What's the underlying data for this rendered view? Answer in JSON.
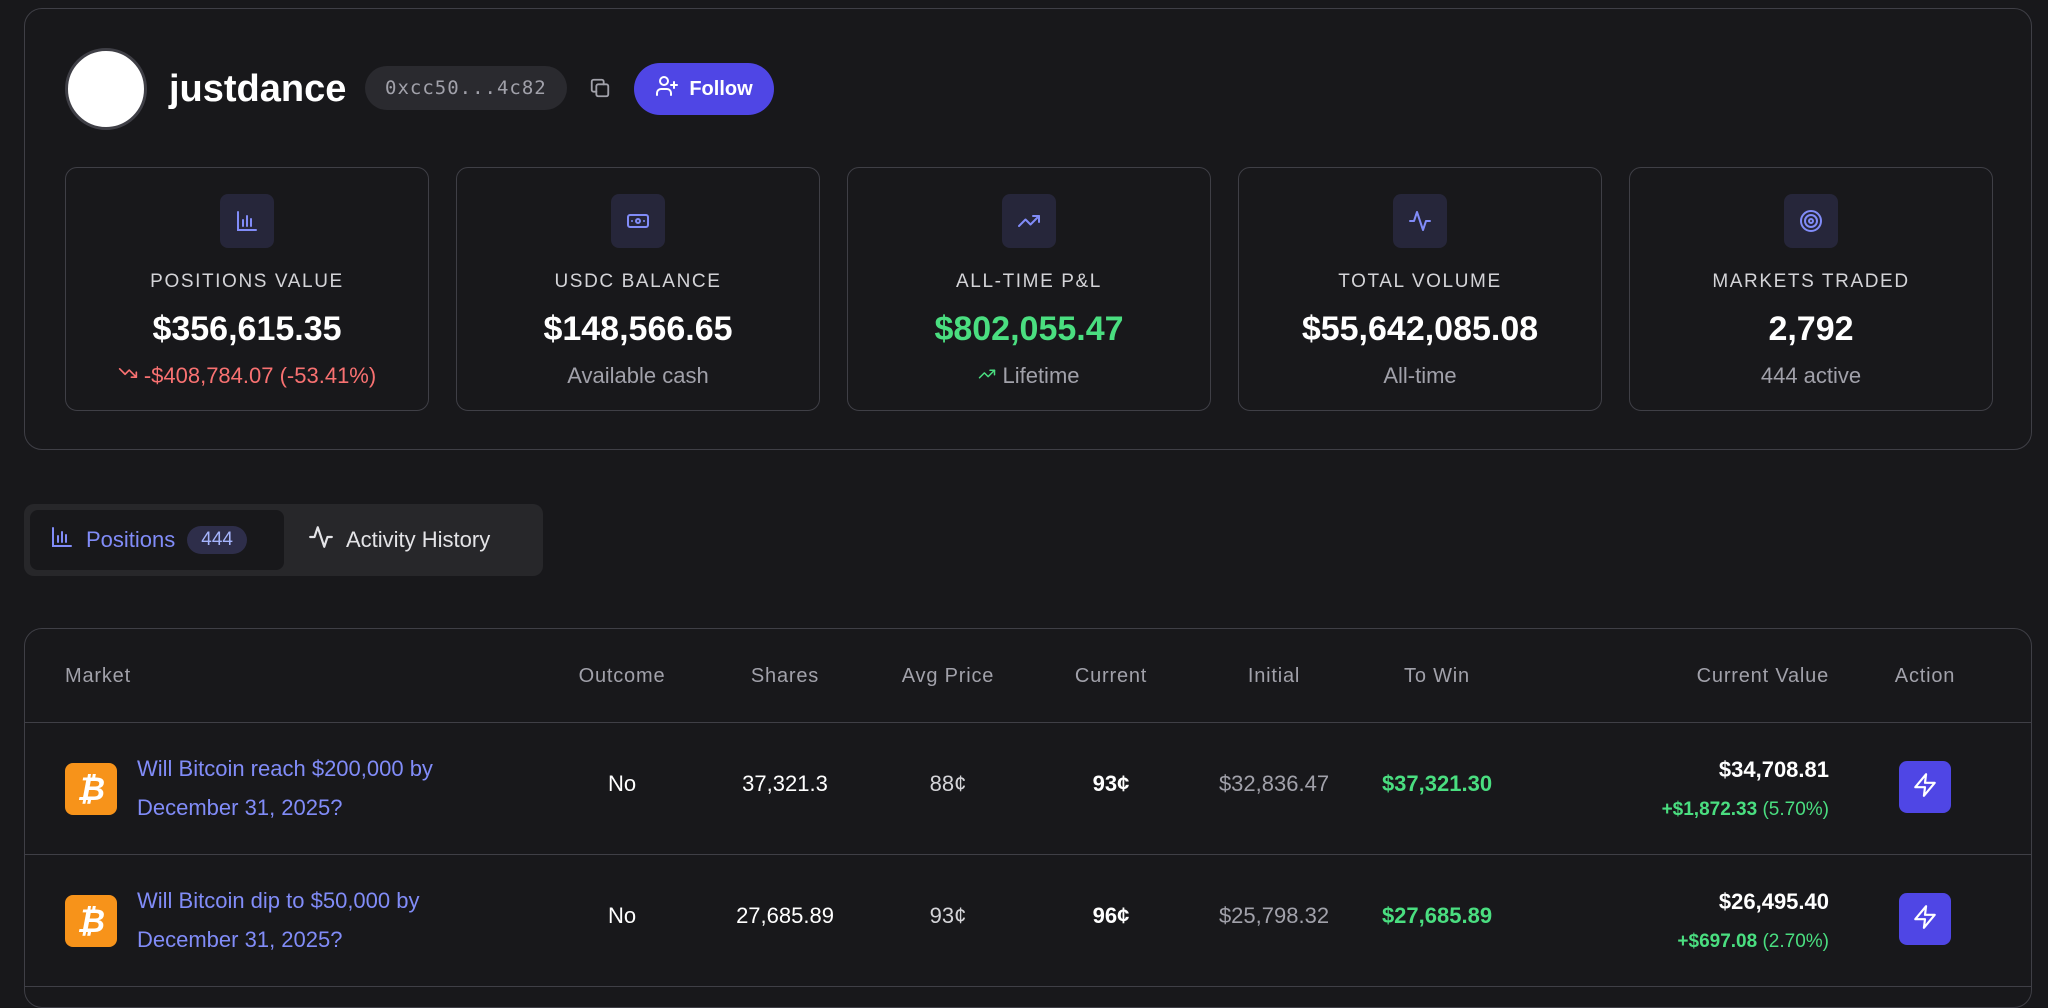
{
  "profile": {
    "username": "justdance",
    "address": "0xcc50...4c82",
    "follow_label": "Follow"
  },
  "stats": [
    {
      "icon": "bar-chart-icon",
      "label": "POSITIONS VALUE",
      "value": "$356,615.35",
      "sub": "-$408,784.07 (-53.41%)",
      "sub_icon": "trending-down-icon"
    },
    {
      "icon": "cash-icon",
      "label": "USDC BALANCE",
      "value": "$148,566.65",
      "sub": "Available cash"
    },
    {
      "icon": "trending-up-icon",
      "label": "ALL-TIME P&L",
      "value": "$802,055.47",
      "sub": "Lifetime",
      "sub_icon": "trending-up-icon"
    },
    {
      "icon": "activity-icon",
      "label": "TOTAL VOLUME",
      "value": "$55,642,085.08",
      "sub": "All-time"
    },
    {
      "icon": "target-icon",
      "label": "MARKETS TRADED",
      "value": "2,792",
      "sub": "444 active"
    }
  ],
  "tabs": {
    "positions": {
      "label": "Positions",
      "count": "444"
    },
    "activity": {
      "label": "Activity History"
    }
  },
  "table": {
    "headers": {
      "market": "Market",
      "outcome": "Outcome",
      "shares": "Shares",
      "avg_price": "Avg Price",
      "current": "Current",
      "initial": "Initial",
      "to_win": "To Win",
      "current_value": "Current Value",
      "action": "Action"
    },
    "rows": [
      {
        "icon": "bitcoin-icon",
        "icon_glyph": "₿",
        "market": "Will Bitcoin reach $200,000 by December 31, 2025?",
        "outcome": "No",
        "shares": "37,321.3",
        "avg_price": "88¢",
        "current": "93¢",
        "initial": "$32,836.47",
        "to_win": "$37,321.30",
        "current_value": "$34,708.81",
        "change": "+$1,872.33",
        "change_pct": "(5.70%)"
      },
      {
        "icon": "bitcoin-icon",
        "icon_glyph": "₿",
        "market": "Will Bitcoin dip to $50,000 by December 31, 2025?",
        "outcome": "No",
        "shares": "27,685.89",
        "avg_price": "93¢",
        "current": "96¢",
        "initial": "$25,798.32",
        "to_win": "$27,685.89",
        "current_value": "$26,495.40",
        "change": "+$697.08",
        "change_pct": "(2.70%)"
      }
    ]
  },
  "colors": {
    "accent": "#4f46e5",
    "link": "#818cf8",
    "positive": "#4ade80",
    "negative": "#f87171",
    "background": "#18181b",
    "border": "#3f3f46",
    "bitcoin": "#f7931a"
  }
}
